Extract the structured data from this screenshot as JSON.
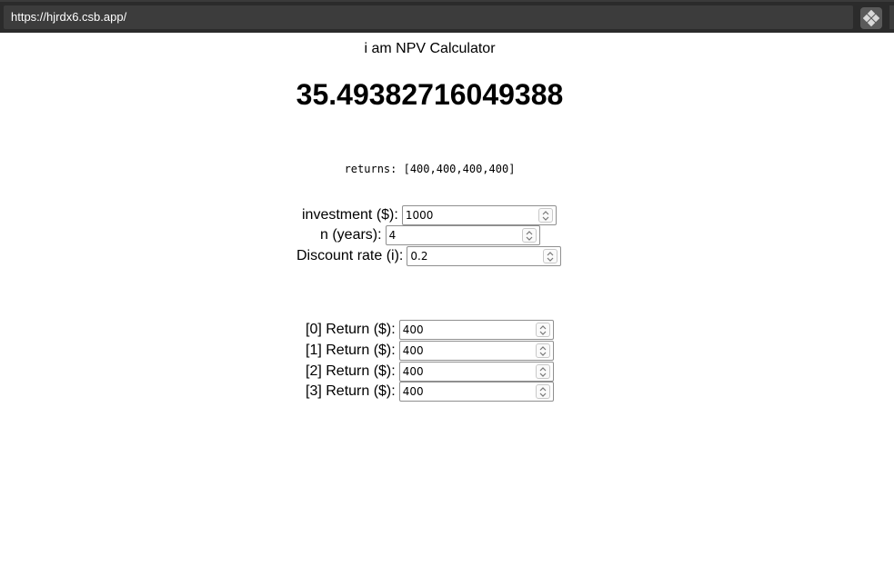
{
  "browser": {
    "url": "https://hjrdx6.csb.app/",
    "extension_icon": "puzzle-icon"
  },
  "app": {
    "title": "i am NPV Calculator",
    "npv_value": "35.49382716049388",
    "returns_text": "returns: [400,400,400,400]"
  },
  "inputs": {
    "investment": {
      "label": "investment ($):",
      "value": "1000"
    },
    "years": {
      "label": "n (years):",
      "value": "4"
    },
    "discount_rate": {
      "label": "Discount rate (i):",
      "value": "0.2"
    }
  },
  "returns_inputs": [
    {
      "label": "[0] Return ($):",
      "value": "400"
    },
    {
      "label": "[1] Return ($):",
      "value": "400"
    },
    {
      "label": "[2] Return ($):",
      "value": "400"
    },
    {
      "label": "[3] Return ($):",
      "value": "400"
    }
  ]
}
